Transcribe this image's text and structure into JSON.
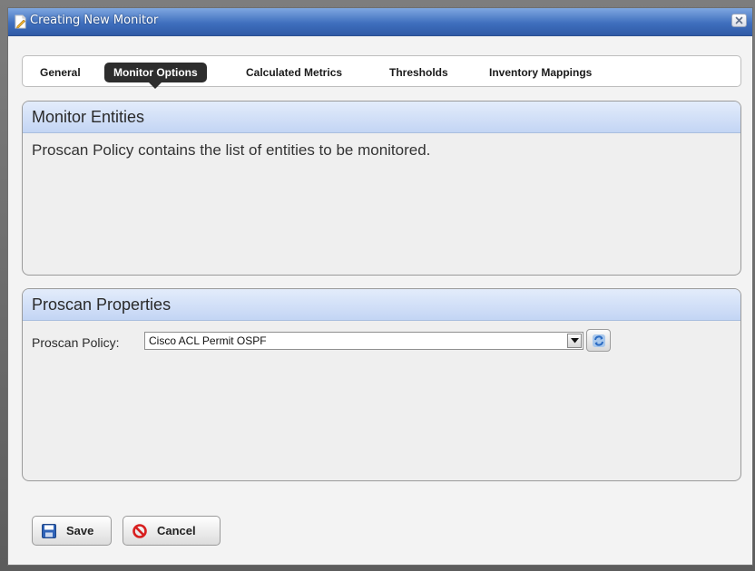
{
  "dialog": {
    "title": "Creating New Monitor",
    "title_icon": "edit-document-icon",
    "close_icon": "close-icon"
  },
  "tabs": [
    {
      "label": "General",
      "active": false
    },
    {
      "label": "Monitor Options",
      "active": true
    },
    {
      "label": "Calculated Metrics",
      "active": false
    },
    {
      "label": "Thresholds",
      "active": false
    },
    {
      "label": "Inventory Mappings",
      "active": false
    }
  ],
  "monitor_entities": {
    "header": "Monitor Entities",
    "description": "Proscan Policy contains the list of entities to be monitored."
  },
  "proscan_properties": {
    "header": "Proscan Properties",
    "policy_label": "Proscan Policy:",
    "policy_value": "Cisco ACL Permit OSPF",
    "dropdown_icon": "chevron-down-icon",
    "refresh_icon": "refresh-icon"
  },
  "buttons": {
    "save_label": "Save",
    "save_icon": "floppy-disk-icon",
    "cancel_label": "Cancel",
    "cancel_icon": "cancel-icon"
  },
  "colors": {
    "titlebar": "#3f6fbe",
    "active_tab": "#2d2d2d",
    "panel_header": "#c3d5f4",
    "cancel_red": "#d81f1f",
    "save_blue": "#2f63b8"
  }
}
